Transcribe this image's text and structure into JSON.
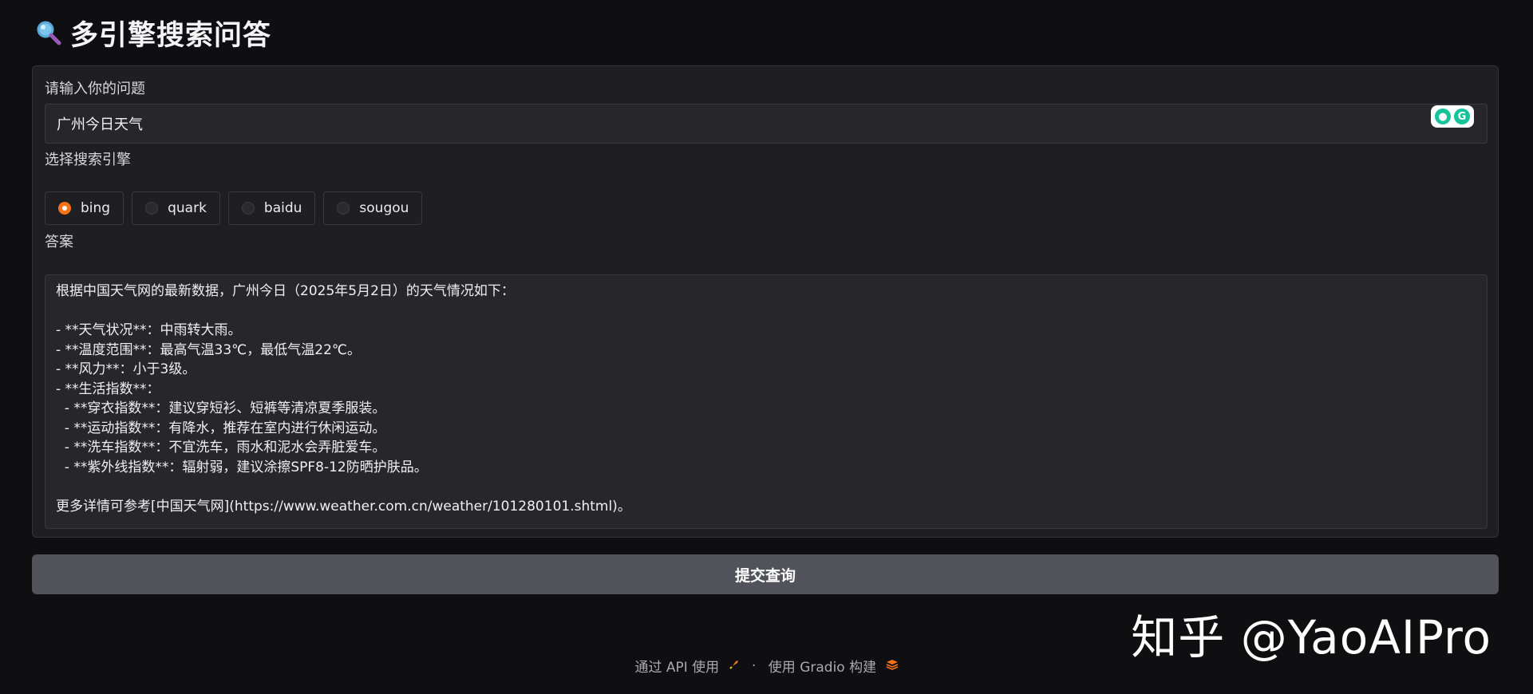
{
  "app": {
    "title": "多引擎搜索问答",
    "title_icon": "magnifier-icon"
  },
  "question": {
    "label": "请输入你的问题",
    "value": "广州今日天气"
  },
  "engine": {
    "label": "选择搜索引擎",
    "options": [
      "bing",
      "quark",
      "baidu",
      "sougou"
    ],
    "selected": "bing"
  },
  "answer": {
    "label": "答案",
    "text": "根据中国天气网的最新数据，广州今日（2025年5月2日）的天气情况如下：\n\n- **天气状况**：中雨转大雨。\n- **温度范围**：最高气温33℃，最低气温22℃。\n- **风力**：小于3级。\n- **生活指数**：\n  - **穿衣指数**：建议穿短衫、短裤等清凉夏季服装。\n  - **运动指数**：有降水，推荐在室内进行休闲运动。\n  - **洗车指数**：不宜洗车，雨水和泥水会弄脏爱车。\n  - **紫外线指数**：辐射弱，建议涂擦SPF8-12防晒护肤品。\n\n更多详情可参考[中国天气网](https://www.weather.com.cn/weather/101280101.shtml)。"
  },
  "submit": {
    "label": "提交查询"
  },
  "watermark": {
    "text": "知乎 @YaoAIPro"
  },
  "footer": {
    "api_link": "通过 API 使用",
    "separator": "·",
    "built_with": "使用 Gradio 构建"
  },
  "colors": {
    "accent": "#f97316",
    "background": "#0f0f12",
    "panel": "#1f1f23",
    "button": "#52525b"
  }
}
